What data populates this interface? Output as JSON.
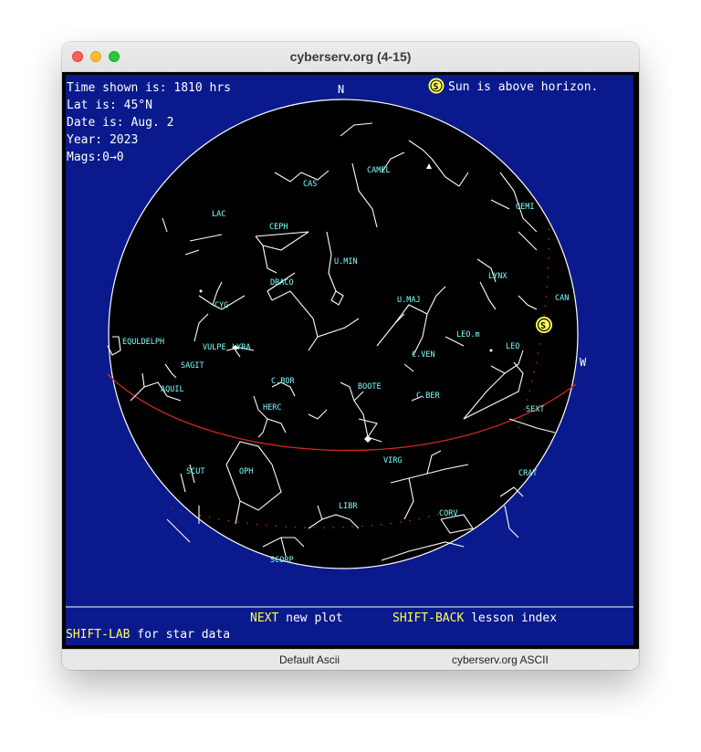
{
  "window": {
    "title": "cyberserv.org (4-15)"
  },
  "info": {
    "time": "Time shown is: 1810 hrs",
    "lat": "Lat is: 45°N",
    "date": "Date is: Aug. 2",
    "year": "Year: 2023",
    "mags": "Mags:0→0",
    "sun_symbol": "S",
    "sun_status": "Sun is above horizon."
  },
  "directions": {
    "north": "N",
    "west": "W"
  },
  "constellations": [
    "CAS",
    "CAMEL",
    "GEMI",
    "LAC",
    "CEPH",
    "U.MIN",
    "LYNX",
    "DRACO",
    "CYG",
    "U.MAJ",
    "CAN",
    "EQULDELPH",
    "VULPE",
    "LYRA",
    "LEO.m",
    "SAGIT",
    "C.VEN",
    "LEO",
    "C.BOR",
    "BOOTE",
    "AQUIL",
    "HERC",
    "C.BER",
    "SEXT",
    "SCUT",
    "OPH",
    "VIRG",
    "CRAT",
    "LIBR",
    "CORV",
    "SCORP"
  ],
  "footer": {
    "next_key": "NEXT",
    "next_text": " new plot",
    "shift_back_key": "SHIFT-BACK",
    "shift_back_text": " lesson index",
    "shift_lab_key": "SHIFT-LAB",
    "shift_lab_text": " for star data"
  },
  "statusbar": {
    "left": "Default Ascii",
    "right": "cyberserv.org ASCII"
  },
  "colors": {
    "background": "#0a1a8c",
    "sky": "#000000",
    "lines": "#ffffff",
    "labels": "#7fffff",
    "text": "#ffffff",
    "keys": "#ffff55",
    "sun": "#ffff55",
    "ecliptic": "#cc2a1a"
  }
}
